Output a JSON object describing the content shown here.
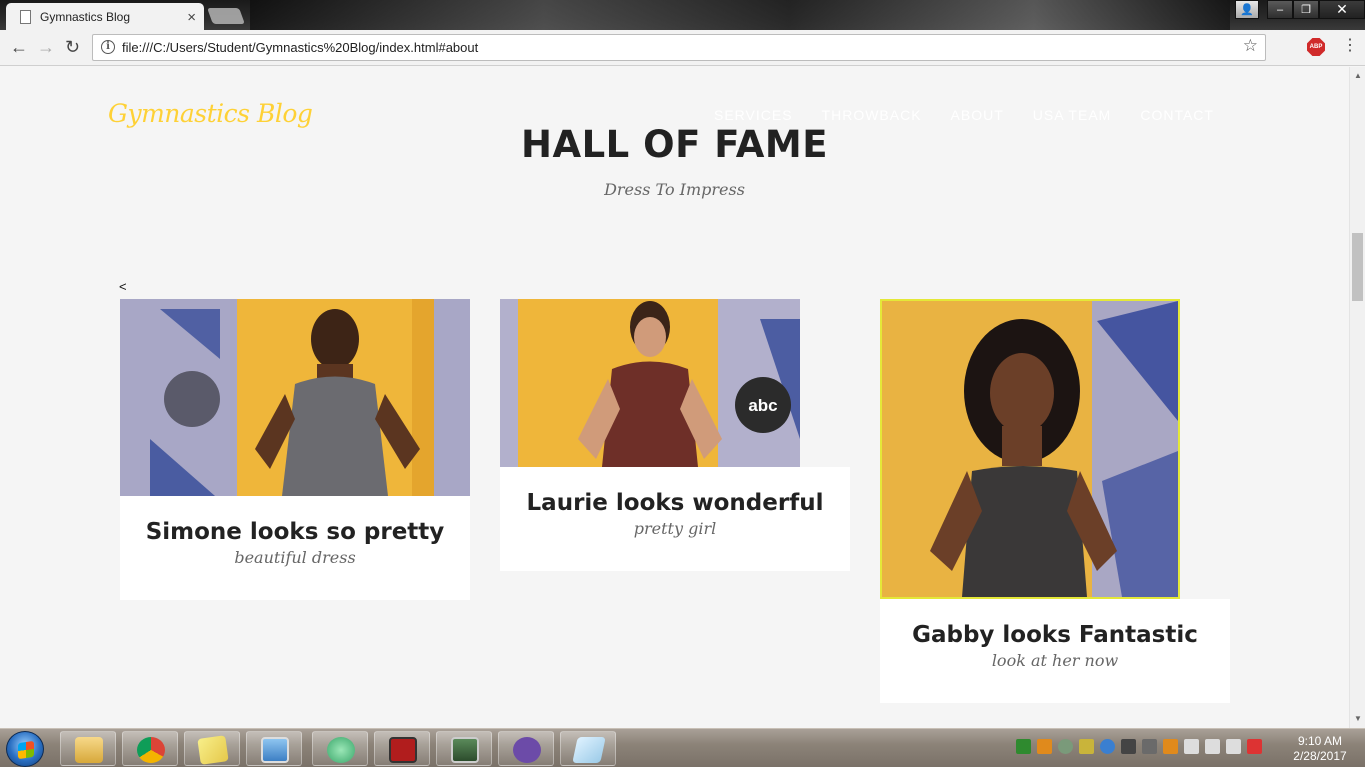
{
  "browser": {
    "tab_title": "Gymnastics Blog",
    "tab_close": "×",
    "url": "file:///C:/Users/Student/Gymnastics%20Blog/index.html#about",
    "back": "←",
    "forward": "→",
    "reload": "↻",
    "star": "☆",
    "abp": "ABP",
    "menu": "⋮",
    "info": "i",
    "window": {
      "user": "👤",
      "minimize": "–",
      "maximize": "❐",
      "close": "✕"
    }
  },
  "site": {
    "brand": "Gymnastics Blog",
    "nav": [
      "SERVICES",
      "THROWBACK",
      "ABOUT",
      "USA TEAM",
      "CONTACT"
    ]
  },
  "section": {
    "title": "HALL OF FAME",
    "subtitle": "Dress To Impress",
    "prev_arrow": "<"
  },
  "cards": [
    {
      "title": "Simone looks so pretty",
      "subtitle": "beautiful dress"
    },
    {
      "title": "Laurie looks wonderful",
      "subtitle": "pretty girl"
    },
    {
      "title": "Gabby looks Fantastic",
      "subtitle": "look at her now"
    }
  ],
  "taskbar": {
    "time": "9:10 AM",
    "date": "2/28/2017"
  }
}
